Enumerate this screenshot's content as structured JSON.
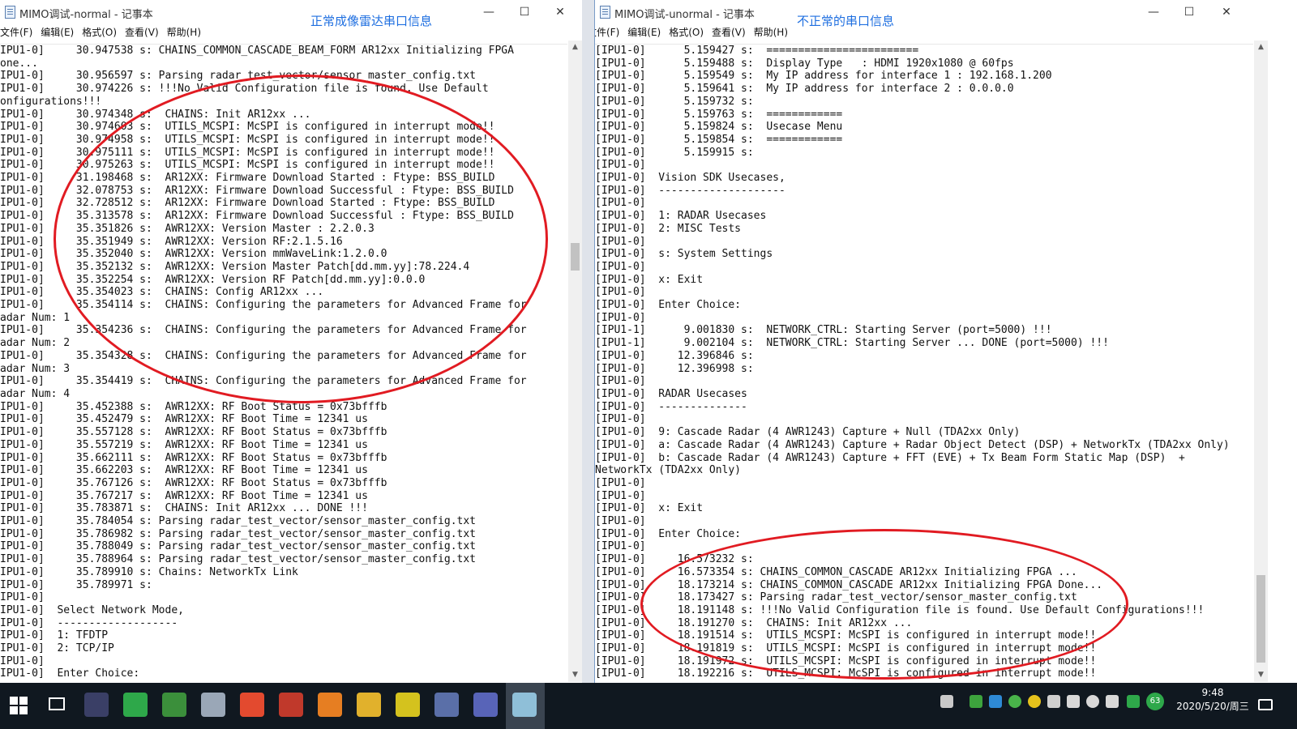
{
  "left_window": {
    "title": "MIMO调试-normal - 记事本",
    "annotation": "正常成像雷达串口信息",
    "menu": [
      "文件(F)",
      "编辑(E)",
      "格式(O)",
      "查看(V)",
      "帮助(H)"
    ],
    "lines": [
      "IPU1-0]     30.947538 s: CHAINS_COMMON_CASCADE_BEAM_FORM AR12xx Initializing FPGA",
      "one...",
      "IPU1-0]     30.956597 s: Parsing radar_test_vector/sensor_master_config.txt",
      "IPU1-0]     30.974226 s: !!!No Valid Configuration file is found. Use Default",
      "onfigurations!!!",
      "IPU1-0]     30.974348 s:  CHAINS: Init AR12xx ...",
      "IPU1-0]     30.974603 s:  UTILS_MCSPI: McSPI is configured in interrupt mode!!",
      "IPU1-0]     30.974958 s:  UTILS_MCSPI: McSPI is configured in interrupt mode!!",
      "IPU1-0]     30.975111 s:  UTILS_MCSPI: McSPI is configured in interrupt mode!!",
      "IPU1-0]     30.975263 s:  UTILS_MCSPI: McSPI is configured in interrupt mode!!",
      "IPU1-0]     31.198468 s:  AR12XX: Firmware Download Started : Ftype: BSS_BUILD",
      "IPU1-0]     32.078753 s:  AR12XX: Firmware Download Successful : Ftype: BSS_BUILD",
      "IPU1-0]     32.728512 s:  AR12XX: Firmware Download Started : Ftype: BSS_BUILD",
      "IPU1-0]     35.313578 s:  AR12XX: Firmware Download Successful : Ftype: BSS_BUILD",
      "IPU1-0]     35.351826 s:  AWR12XX: Version Master : 2.2.0.3",
      "IPU1-0]     35.351949 s:  AWR12XX: Version RF:2.1.5.16",
      "IPU1-0]     35.352040 s:  AWR12XX: Version mmWaveLink:1.2.0.0",
      "IPU1-0]     35.352132 s:  AWR12XX: Version Master Patch[dd.mm.yy]:78.224.4",
      "IPU1-0]     35.352254 s:  AWR12XX: Version RF Patch[dd.mm.yy]:0.0.0",
      "IPU1-0]     35.354023 s:  CHAINS: Config AR12xx ...",
      "IPU1-0]     35.354114 s:  CHAINS: Configuring the parameters for Advanced Frame for",
      "adar Num: 1",
      "IPU1-0]     35.354236 s:  CHAINS: Configuring the parameters for Advanced Frame for",
      "adar Num: 2",
      "IPU1-0]     35.354328 s:  CHAINS: Configuring the parameters for Advanced Frame for",
      "adar Num: 3",
      "IPU1-0]     35.354419 s:  CHAINS: Configuring the parameters for Advanced Frame for",
      "adar Num: 4",
      "IPU1-0]     35.452388 s:  AWR12XX: RF Boot Status = 0x73bfffb",
      "IPU1-0]     35.452479 s:  AWR12XX: RF Boot Time = 12341 us",
      "IPU1-0]     35.557128 s:  AWR12XX: RF Boot Status = 0x73bfffb",
      "IPU1-0]     35.557219 s:  AWR12XX: RF Boot Time = 12341 us",
      "IPU1-0]     35.662111 s:  AWR12XX: RF Boot Status = 0x73bfffb",
      "IPU1-0]     35.662203 s:  AWR12XX: RF Boot Time = 12341 us",
      "IPU1-0]     35.767126 s:  AWR12XX: RF Boot Status = 0x73bfffb",
      "IPU1-0]     35.767217 s:  AWR12XX: RF Boot Time = 12341 us",
      "IPU1-0]     35.783871 s:  CHAINS: Init AR12xx ... DONE !!!",
      "IPU1-0]     35.784054 s: Parsing radar_test_vector/sensor_master_config.txt",
      "IPU1-0]     35.786982 s: Parsing radar_test_vector/sensor_master_config.txt",
      "IPU1-0]     35.788049 s: Parsing radar_test_vector/sensor_master_config.txt",
      "IPU1-0]     35.788964 s: Parsing radar_test_vector/sensor_master_config.txt",
      "IPU1-0]     35.789910 s: Chains: NetworkTx Link",
      "IPU1-0]     35.789971 s:",
      "IPU1-0]",
      "IPU1-0]  Select Network Mode,",
      "IPU1-0]  -------------------",
      "IPU1-0]  1: TFDTP",
      "IPU1-0]  2: TCP/IP",
      "IPU1-0]",
      "IPU1-0]  Enter Choice:"
    ]
  },
  "right_window": {
    "title": "MIMO调试-unormal - 记事本",
    "annotation": "不正常的串口信息",
    "menu": [
      "文件(F)",
      "编辑(E)",
      "格式(O)",
      "查看(V)",
      "帮助(H)"
    ],
    "lines": [
      "[IPU1-0]      5.159427 s:  ========================",
      "[IPU1-0]      5.159488 s:  Display Type   : HDMI 1920x1080 @ 60fps",
      "[IPU1-0]      5.159549 s:  My IP address for interface 1 : 192.168.1.200",
      "[IPU1-0]      5.159641 s:  My IP address for interface 2 : 0.0.0.0",
      "[IPU1-0]      5.159732 s:",
      "[IPU1-0]      5.159763 s:  ============",
      "[IPU1-0]      5.159824 s:  Usecase Menu",
      "[IPU1-0]      5.159854 s:  ============",
      "[IPU1-0]      5.159915 s:",
      "[IPU1-0]",
      "[IPU1-0]  Vision SDK Usecases,",
      "[IPU1-0]  --------------------",
      "[IPU1-0]",
      "[IPU1-0]  1: RADAR Usecases",
      "[IPU1-0]  2: MISC Tests",
      "[IPU1-0]",
      "[IPU1-0]  s: System Settings",
      "[IPU1-0]",
      "[IPU1-0]  x: Exit",
      "[IPU1-0]",
      "[IPU1-0]  Enter Choice:",
      "[IPU1-0]",
      "[IPU1-1]      9.001830 s:  NETWORK_CTRL: Starting Server (port=5000) !!!",
      "[IPU1-1]      9.002104 s:  NETWORK_CTRL: Starting Server ... DONE (port=5000) !!!",
      "[IPU1-0]     12.396846 s:",
      "[IPU1-0]     12.396998 s:",
      "[IPU1-0]",
      "[IPU1-0]  RADAR Usecases",
      "[IPU1-0]  --------------",
      "[IPU1-0]",
      "[IPU1-0]  9: Cascade Radar (4 AWR1243) Capture + Null (TDA2xx Only)",
      "[IPU1-0]  a: Cascade Radar (4 AWR1243) Capture + Radar Object Detect (DSP) + NetworkTx (TDA2xx Only)",
      "[IPU1-0]  b: Cascade Radar (4 AWR1243) Capture + FFT (EVE) + Tx Beam Form Static Map (DSP)  +",
      "NetworkTx (TDA2xx Only)",
      "[IPU1-0]",
      "[IPU1-0]",
      "[IPU1-0]  x: Exit",
      "[IPU1-0]",
      "[IPU1-0]  Enter Choice:",
      "[IPU1-0]",
      "[IPU1-0]     16.573232 s:",
      "[IPU1-0]     16.573354 s: CHAINS_COMMON_CASCADE AR12xx Initializing FPGA ...",
      "[IPU1-0]     18.173214 s: CHAINS_COMMON_CASCADE AR12xx Initializing FPGA Done...",
      "[IPU1-0]     18.173427 s: Parsing radar_test_vector/sensor_master_config.txt",
      "[IPU1-0]     18.191148 s: !!!No Valid Configuration file is found. Use Default Configurations!!!",
      "[IPU1-0]     18.191270 s:  CHAINS: Init AR12xx ...",
      "[IPU1-0]     18.191514 s:  UTILS_MCSPI: McSPI is configured in interrupt mode!!",
      "[IPU1-0]     18.191819 s:  UTILS_MCSPI: McSPI is configured in interrupt mode!!",
      "[IPU1-0]     18.191972 s:  UTILS_MCSPI: McSPI is configured in interrupt mode!!",
      "[IPU1-0]     18.192216 s:  UTILS_MCSPI: McSPI is configured in interrupt mode!!"
    ]
  },
  "window_controls": {
    "minimize": "—",
    "maximize": "☐",
    "close": "✕"
  },
  "taskbar": {
    "time": "9:48",
    "date": "2020/5/20/周三",
    "badge": "63",
    "apps": [
      "file-manager",
      "green-app",
      "network-tool",
      "paint-app",
      "chrome",
      "matlab",
      "ppt",
      "folder",
      "terminal",
      "image-viewer",
      "city-app",
      "notepad"
    ]
  },
  "colors": {
    "annotation_text": "#1f6fe0",
    "ellipse": "#e11b22",
    "taskbar": "#101820"
  }
}
